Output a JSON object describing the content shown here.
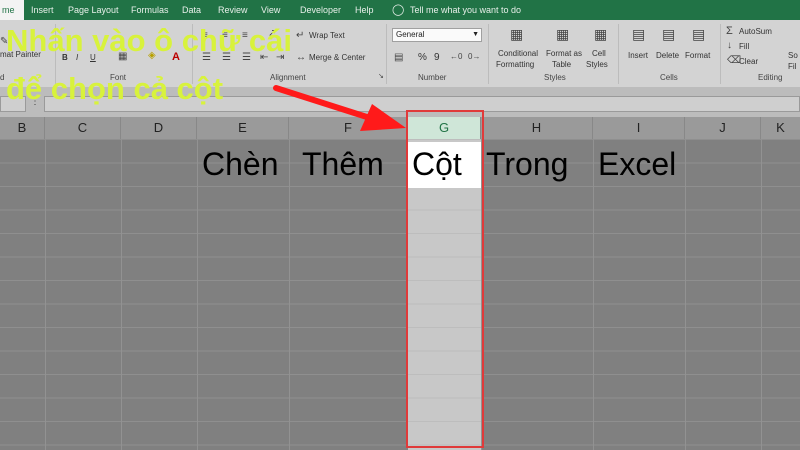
{
  "menu": {
    "tabs": [
      {
        "label": "me",
        "active": true
      },
      {
        "label": "Insert"
      },
      {
        "label": "Page Layout"
      },
      {
        "label": "Formulas"
      },
      {
        "label": "Data"
      },
      {
        "label": "Review"
      },
      {
        "label": "View"
      },
      {
        "label": "Developer"
      },
      {
        "label": "Help"
      }
    ],
    "tell_me": "Tell me what you want to do"
  },
  "ribbon": {
    "clipboard": {
      "format_painter": "mat Painter",
      "group_label": "d"
    },
    "font": {
      "bold": "B",
      "italic": "I",
      "underline": "U",
      "font_color": "A",
      "group_label": "Font"
    },
    "alignment": {
      "wrap_text": "Wrap Text",
      "merge_center": "Merge & Center",
      "group_label": "Alignment"
    },
    "number": {
      "format_value": "General",
      "percent": "%",
      "comma": "9",
      "group_label": "Number"
    },
    "styles": {
      "conditional_formatting": [
        "Conditional",
        "Formatting"
      ],
      "format_as_table": [
        "Format as",
        "Table"
      ],
      "cell_styles": [
        "Cell",
        "Styles"
      ],
      "group_label": "Styles"
    },
    "cells": {
      "insert": "Insert",
      "delete": "Delete",
      "format": "Format",
      "group_label": "Cells"
    },
    "editing": {
      "autosum": "AutoSum",
      "fill": "Fill",
      "clear": "Clear",
      "group_label": "Editing",
      "sort_partial": [
        "So",
        "Fil"
      ]
    }
  },
  "sheet": {
    "columns": [
      "B",
      "C",
      "D",
      "E",
      "F",
      "G",
      "H",
      "I",
      "J",
      "K"
    ],
    "selected_column": "G",
    "row_text": [
      "Chèn",
      "Thêm",
      "Cột",
      "Trong",
      "Excel"
    ]
  },
  "annotation": {
    "line1": "Nhấn vào ô chữ cái",
    "line2": "để chọn cả cột",
    "arrow_color": "#ff1a1a",
    "text_color": "#d8f23c"
  },
  "colors": {
    "excel_green": "#217346",
    "selection_border": "#e03a3a"
  }
}
